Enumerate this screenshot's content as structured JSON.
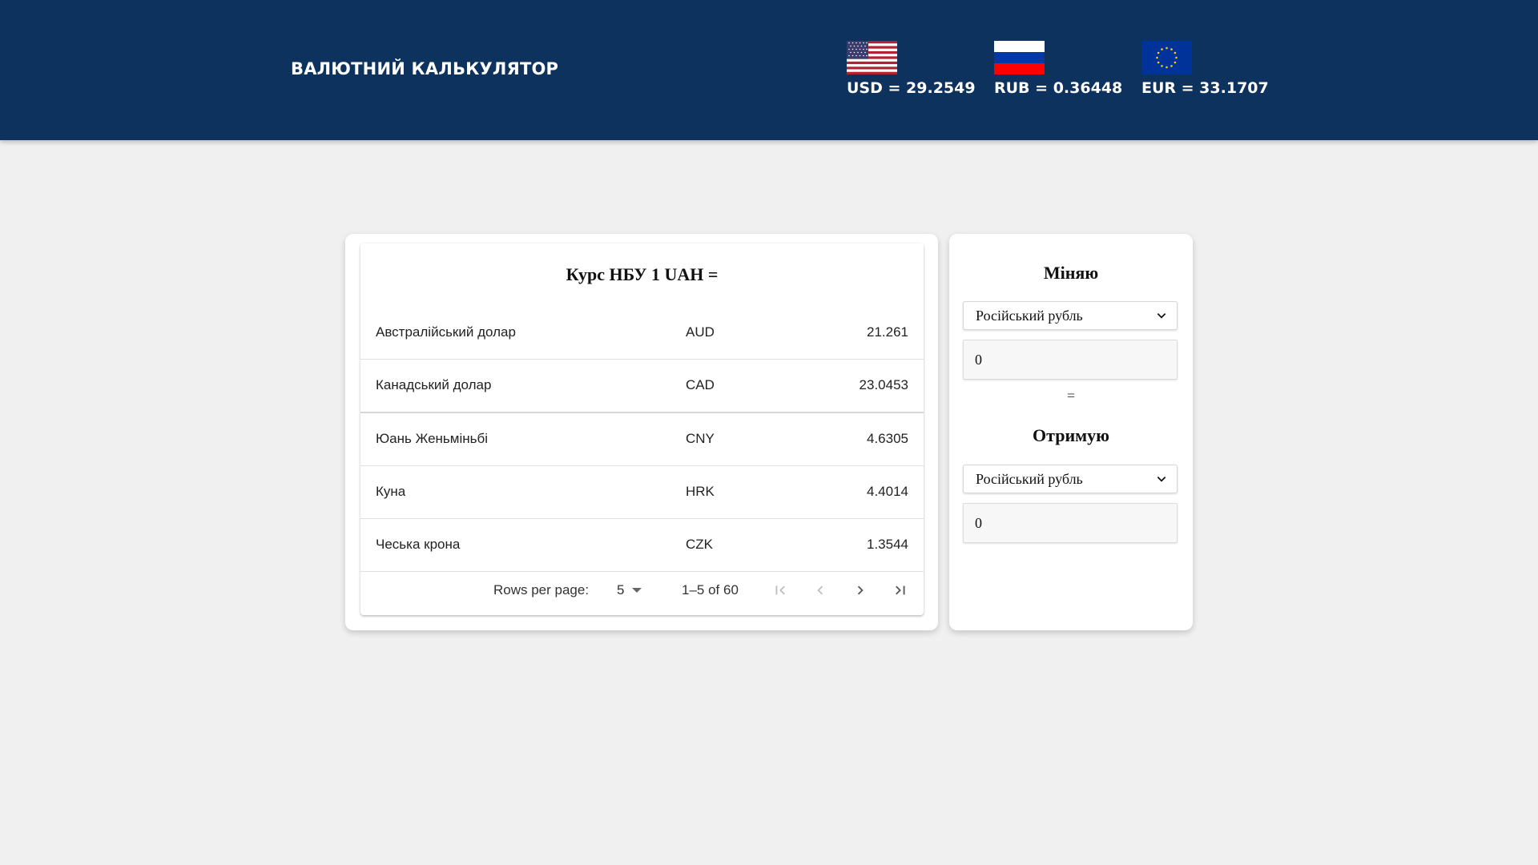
{
  "header": {
    "title": "ВАЛЮТНИЙ КАЛЬКУЛЯТОР",
    "rates": [
      {
        "code": "USD",
        "text": "USD = 29.2549",
        "flag_icon": "us-flag-icon"
      },
      {
        "code": "RUB",
        "text": "RUB = 0.36448",
        "flag_icon": "ru-flag-icon"
      },
      {
        "code": "EUR",
        "text": "EUR = 33.1707",
        "flag_icon": "eu-flag-icon"
      }
    ]
  },
  "rates_table": {
    "title": "Курс НБУ 1 UAH =",
    "rows": [
      {
        "name": "Австралійський долар",
        "code": "AUD",
        "value": "21.261"
      },
      {
        "name": "Канадський долар",
        "code": "CAD",
        "value": "23.0453"
      },
      {
        "name": "Юань Женьміньбі",
        "code": "CNY",
        "value": "4.6305"
      },
      {
        "name": "Куна",
        "code": "HRK",
        "value": "4.4014"
      },
      {
        "name": "Чеська крона",
        "code": "CZK",
        "value": "1.3544"
      }
    ],
    "pagination": {
      "rows_per_page_label": "Rows per page:",
      "rows_per_page_value": "5",
      "range_text": "1–5 of 60"
    }
  },
  "converter": {
    "give_label": "Міняю",
    "give_currency": "Російський рубль",
    "give_amount": "0",
    "equals_sign": "=",
    "get_label": "Отримую",
    "get_currency": "Російський рубль",
    "get_amount": "0"
  },
  "colors": {
    "header_bg": "#0d325e",
    "page_bg": "#f0f0f0",
    "panel_bg": "#ffffff"
  }
}
